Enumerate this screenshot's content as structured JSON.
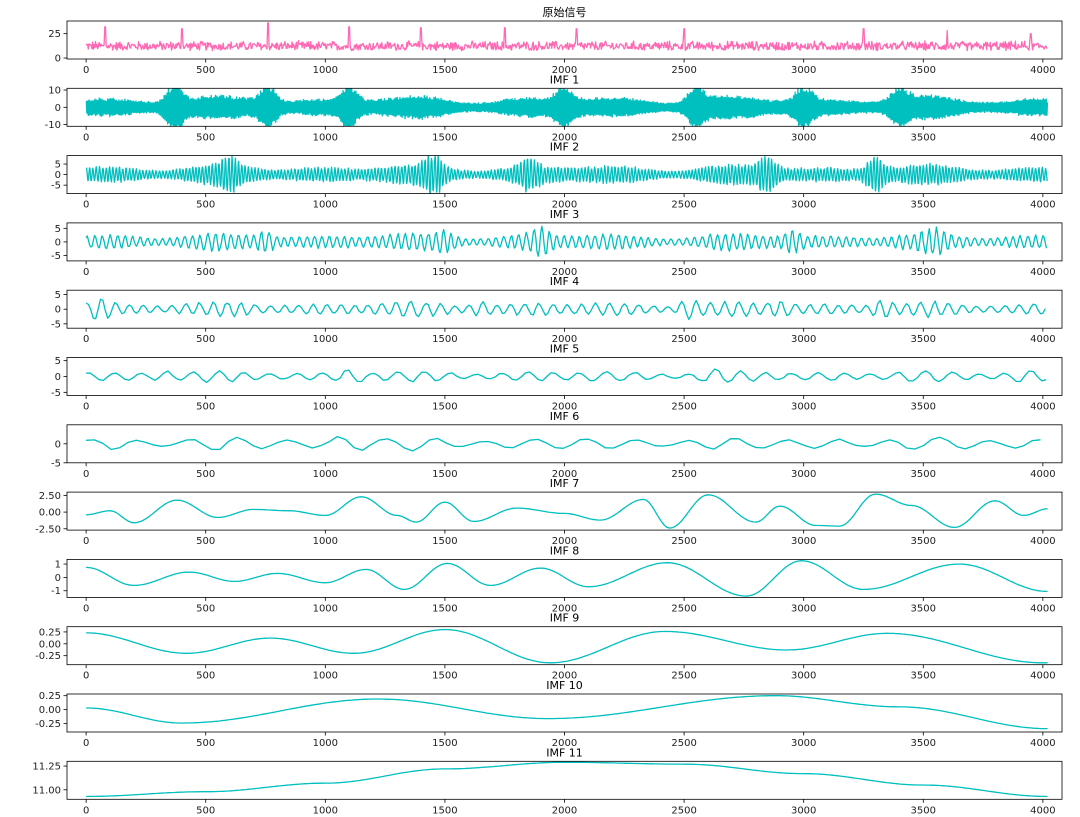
{
  "figure": {
    "title": "原始信号"
  },
  "chart_data": [
    {
      "type": "line",
      "title": "原始信号",
      "color": "#ff69b4",
      "xlim": [
        -80,
        4080
      ],
      "ylim": [
        -1,
        38
      ],
      "xticks": [
        0,
        500,
        1000,
        1500,
        2000,
        2500,
        3000,
        3500,
        4000
      ],
      "yticks": [
        0,
        25
      ],
      "series": [
        {
          "kind": "noise",
          "n": 4020,
          "base": 11,
          "amp": 9,
          "spikes": [
            [
              80,
              32
            ],
            [
              400,
              30
            ],
            [
              760,
              36
            ],
            [
              1100,
              32
            ],
            [
              1400,
              31
            ],
            [
              1750,
              31
            ],
            [
              2050,
              30
            ],
            [
              2500,
              30
            ],
            [
              3250,
              30
            ],
            [
              3600,
              28
            ],
            [
              3950,
              25
            ]
          ]
        }
      ]
    },
    {
      "type": "line",
      "title": "IMF 1",
      "color": "#00bfbf",
      "xlim": [
        -80,
        4080
      ],
      "ylim": [
        -11,
        11
      ],
      "xticks": [
        0,
        500,
        1000,
        1500,
        2000,
        2500,
        3000,
        3500,
        4000
      ],
      "yticks": [
        -10,
        0,
        10
      ],
      "series": [
        {
          "kind": "osc",
          "n": 4020,
          "period": 6,
          "amp": 5.5,
          "bursts": [
            [
              370,
              10
            ],
            [
              760,
              9
            ],
            [
              1100,
              8.5
            ],
            [
              2000,
              8
            ],
            [
              2550,
              9
            ],
            [
              3000,
              8
            ],
            [
              3400,
              7
            ]
          ]
        }
      ]
    },
    {
      "type": "line",
      "title": "IMF 2",
      "color": "#00bfbf",
      "xlim": [
        -80,
        4080
      ],
      "ylim": [
        -9,
        9
      ],
      "xticks": [
        0,
        500,
        1000,
        1500,
        2000,
        2500,
        3000,
        3500,
        4000
      ],
      "yticks": [
        -5,
        0,
        5
      ],
      "series": [
        {
          "kind": "osc",
          "n": 4020,
          "period": 14,
          "amp": 4,
          "bursts": [
            [
              1450,
              8
            ],
            [
              1850,
              6
            ],
            [
              2850,
              8
            ],
            [
              3300,
              8
            ],
            [
              600,
              6
            ]
          ]
        }
      ]
    },
    {
      "type": "line",
      "title": "IMF 3",
      "color": "#00bfbf",
      "xlim": [
        -80,
        4080
      ],
      "ylim": [
        -7,
        7
      ],
      "xticks": [
        0,
        500,
        1000,
        1500,
        2000,
        2500,
        3000,
        3500,
        4000
      ],
      "yticks": [
        -5,
        0,
        5
      ],
      "series": [
        {
          "kind": "osc",
          "n": 4020,
          "period": 32,
          "amp": 2.8,
          "bursts": [
            [
              1900,
              6.5
            ],
            [
              1500,
              4.5
            ],
            [
              2950,
              4.5
            ],
            [
              3550,
              3.5
            ],
            [
              750,
              4
            ]
          ]
        }
      ]
    },
    {
      "type": "line",
      "title": "IMF 4",
      "color": "#00bfbf",
      "xlim": [
        -80,
        4080
      ],
      "ylim": [
        -6.5,
        6.5
      ],
      "xticks": [
        0,
        500,
        1000,
        1500,
        2000,
        2500,
        3000,
        3500,
        4000
      ],
      "yticks": [
        -5,
        0,
        5
      ],
      "series": [
        {
          "kind": "osc",
          "n": 4020,
          "period": 60,
          "amp": 2.2,
          "bursts": [
            [
              60,
              5.5
            ],
            [
              2520,
              5.5
            ],
            [
              3330,
              5.5
            ],
            [
              1650,
              3.5
            ],
            [
              2900,
              4
            ]
          ]
        }
      ]
    },
    {
      "type": "line",
      "title": "IMF 5",
      "color": "#00bfbf",
      "xlim": [
        -80,
        4080
      ],
      "ylim": [
        -6,
        6
      ],
      "xticks": [
        0,
        500,
        1000,
        1500,
        2000,
        2500,
        3000,
        3500,
        4000
      ],
      "yticks": [
        -5,
        0,
        5
      ],
      "series": [
        {
          "kind": "osc",
          "n": 4020,
          "period": 110,
          "amp": 1.6,
          "bursts": [
            [
              1110,
              5.5
            ],
            [
              330,
              3.5
            ],
            [
              2630,
              3.5
            ],
            [
              3930,
              3
            ]
          ]
        }
      ]
    },
    {
      "type": "line",
      "title": "IMF 6",
      "color": "#00bfbf",
      "xlim": [
        -80,
        4080
      ],
      "ylim": [
        -5,
        5
      ],
      "xticks": [
        0,
        500,
        1000,
        1500,
        2000,
        2500,
        3000,
        3500,
        4000
      ],
      "yticks": [
        -5,
        0
      ],
      "series": [
        {
          "kind": "osc",
          "n": 4020,
          "period": 210,
          "amp": 1.5,
          "bursts": [
            [
              1080,
              4.6
            ],
            [
              1150,
              4
            ],
            [
              700,
              2.5
            ],
            [
              3700,
              2.5
            ],
            [
              90,
              2.5
            ]
          ]
        }
      ]
    },
    {
      "type": "line",
      "title": "IMF 7",
      "color": "#00bfbf",
      "xlim": [
        -80,
        4080
      ],
      "ylim": [
        -2.7,
        3
      ],
      "xticks": [
        0,
        500,
        1000,
        1500,
        2000,
        2500,
        3000,
        3500,
        4000
      ],
      "yticks": [
        -2.5,
        0.0,
        2.5
      ],
      "series": [
        {
          "kind": "smooth",
          "points": [
            [
              0,
              -0.4
            ],
            [
              100,
              0.2
            ],
            [
              200,
              -1.6
            ],
            [
              380,
              1.8
            ],
            [
              550,
              -0.8
            ],
            [
              700,
              0.4
            ],
            [
              850,
              0.2
            ],
            [
              1000,
              -0.5
            ],
            [
              1150,
              2.3
            ],
            [
              1300,
              -0.5
            ],
            [
              1380,
              -1.5
            ],
            [
              1500,
              1.5
            ],
            [
              1620,
              -1.4
            ],
            [
              1800,
              0.6
            ],
            [
              2000,
              -0.2
            ],
            [
              2150,
              -1.2
            ],
            [
              2330,
              1.9
            ],
            [
              2440,
              -2.4
            ],
            [
              2600,
              2.6
            ],
            [
              2800,
              -1.5
            ],
            [
              2900,
              0.9
            ],
            [
              3050,
              -2.0
            ],
            [
              3150,
              -2.1
            ],
            [
              3300,
              2.7
            ],
            [
              3450,
              1.0
            ],
            [
              3630,
              -2.3
            ],
            [
              3800,
              1.7
            ],
            [
              3920,
              -0.5
            ],
            [
              4020,
              0.5
            ]
          ]
        }
      ]
    },
    {
      "type": "line",
      "title": "IMF 8",
      "color": "#00bfbf",
      "xlim": [
        -80,
        4080
      ],
      "ylim": [
        -1.5,
        1.35
      ],
      "xticks": [
        0,
        500,
        1000,
        1500,
        2000,
        2500,
        3000,
        3500,
        4000
      ],
      "yticks": [
        -1,
        0,
        1
      ],
      "series": [
        {
          "kind": "smooth",
          "points": [
            [
              0,
              0.75
            ],
            [
              200,
              -0.6
            ],
            [
              430,
              0.4
            ],
            [
              620,
              -0.3
            ],
            [
              800,
              0.3
            ],
            [
              1000,
              -0.4
            ],
            [
              1170,
              0.6
            ],
            [
              1330,
              -0.9
            ],
            [
              1510,
              1.05
            ],
            [
              1690,
              -0.6
            ],
            [
              1900,
              0.7
            ],
            [
              2100,
              -0.7
            ],
            [
              2430,
              1.1
            ],
            [
              2760,
              -1.4
            ],
            [
              2990,
              1.25
            ],
            [
              3250,
              -0.9
            ],
            [
              3650,
              1.0
            ],
            [
              4020,
              -1.05
            ]
          ]
        }
      ]
    },
    {
      "type": "line",
      "title": "IMF 9",
      "color": "#00bfbf",
      "xlim": [
        -80,
        4080
      ],
      "ylim": [
        -0.44,
        0.36
      ],
      "xticks": [
        0,
        500,
        1000,
        1500,
        2000,
        2500,
        3000,
        3500,
        4000
      ],
      "yticks": [
        -0.25,
        0.0,
        0.25
      ],
      "series": [
        {
          "kind": "smooth",
          "points": [
            [
              0,
              0.23
            ],
            [
              420,
              -0.2
            ],
            [
              770,
              0.12
            ],
            [
              1120,
              -0.2
            ],
            [
              1500,
              0.3
            ],
            [
              1940,
              -0.4
            ],
            [
              2420,
              0.26
            ],
            [
              2930,
              -0.13
            ],
            [
              3350,
              0.22
            ],
            [
              4000,
              -0.4
            ],
            [
              4020,
              -0.4
            ]
          ]
        }
      ]
    },
    {
      "type": "line",
      "title": "IMF 10",
      "color": "#00bfbf",
      "xlim": [
        -80,
        4080
      ],
      "ylim": [
        -0.4,
        0.28
      ],
      "xticks": [
        0,
        500,
        1000,
        1500,
        2000,
        2500,
        3000,
        3500,
        4000
      ],
      "yticks": [
        -0.25,
        0.0,
        0.25
      ],
      "series": [
        {
          "kind": "smooth",
          "points": [
            [
              0,
              0.03
            ],
            [
              400,
              -0.24
            ],
            [
              1220,
              0.19
            ],
            [
              1930,
              -0.16
            ],
            [
              2880,
              0.25
            ],
            [
              3400,
              0.05
            ],
            [
              4020,
              -0.34
            ]
          ]
        }
      ]
    },
    {
      "type": "line",
      "title": "IMF 11",
      "color": "#00bfbf",
      "xlim": [
        -80,
        4080
      ],
      "ylim": [
        10.9,
        11.3
      ],
      "xticks": [
        0,
        500,
        1000,
        1500,
        2000,
        2500,
        3000,
        3500,
        4000
      ],
      "yticks": [
        11.0,
        11.25
      ],
      "series": [
        {
          "kind": "smooth",
          "points": [
            [
              0,
              10.93
            ],
            [
              500,
              10.98
            ],
            [
              1000,
              11.07
            ],
            [
              1500,
              11.22
            ],
            [
              2000,
              11.29
            ],
            [
              2500,
              11.27
            ],
            [
              3000,
              11.17
            ],
            [
              3500,
              11.05
            ],
            [
              4020,
              10.93
            ]
          ]
        }
      ]
    }
  ]
}
